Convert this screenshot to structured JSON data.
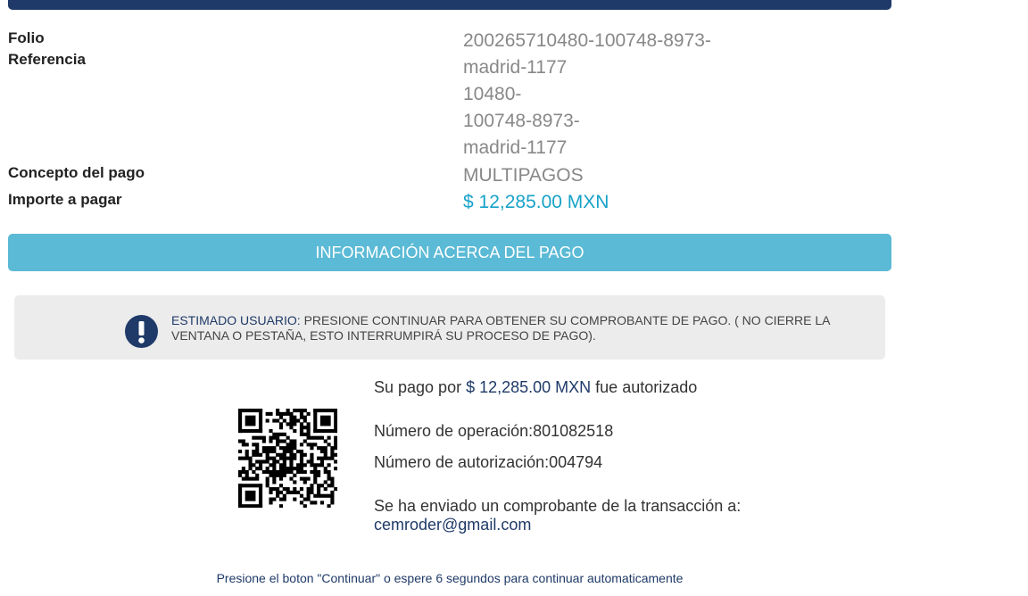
{
  "details": {
    "folio_label": "Folio",
    "referencia_label": "Referencia",
    "folio_referencia_lines": [
      "200265710480-100748-8973-",
      "madrid-1177",
      "10480-",
      "100748-8973-",
      "madrid-1177"
    ],
    "concepto_label": "Concepto del pago",
    "concepto_value": "MULTIPAGOS",
    "importe_label": "Importe a pagar",
    "importe_value": "$ 12,285.00 MXN"
  },
  "info_bar": {
    "label": "INFORMACIÓN ACERCA DEL PAGO"
  },
  "alert": {
    "icon": "exclamation-icon",
    "highlight": "ESTIMADO USUARIO:",
    "message": " PRESIONE CONTINUAR PARA OBTENER SU COMPROBANTE DE PAGO. ( NO CIERRE LA VENTANA O PESTAÑA, ESTO INTERRUMPIRÁ SU PROCESO DE PAGO)."
  },
  "payment": {
    "authorized_prefix": "Su pago por ",
    "authorized_amount": "$ 12,285.00 MXN",
    "authorized_suffix": " fue autorizado",
    "operation_label": "Número de operación:",
    "operation_value": "801082518",
    "authorization_label": "Número de autorización:",
    "authorization_value": "004794",
    "receipt_text": "Se ha enviado un comprobante de la transacción a:",
    "email": "cemroder@gmail.com"
  },
  "footer": {
    "text": "Presione el boton \"Continuar\" o espere 6 segundos para continuar automaticamente"
  },
  "colors": {
    "header_bar": "#1f3a68",
    "info_bar": "#5bbad5",
    "amount": "#17a2c8",
    "alert_bg": "#ececec"
  }
}
